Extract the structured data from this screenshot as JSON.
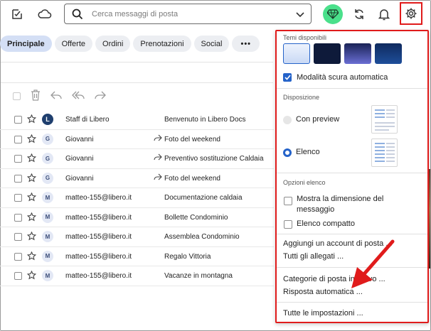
{
  "search": {
    "placeholder": "Cerca messaggi di posta"
  },
  "tabs": [
    {
      "label": "Principale",
      "active": true
    },
    {
      "label": "Offerte"
    },
    {
      "label": "Ordini"
    },
    {
      "label": "Prenotazioni"
    },
    {
      "label": "Social"
    },
    {
      "label": "•••"
    }
  ],
  "emails": [
    {
      "initial": "L",
      "sender": "Staff di Libero",
      "subject": "Benvenuto in Libero Docs",
      "forwarded": false
    },
    {
      "initial": "G",
      "sender": "Giovanni",
      "subject": "Foto del weekend",
      "forwarded": true
    },
    {
      "initial": "G",
      "sender": "Giovanni",
      "subject": "Preventivo sostituzione Caldaia",
      "forwarded": true
    },
    {
      "initial": "G",
      "sender": "Giovanni",
      "subject": "Foto del weekend",
      "forwarded": true
    },
    {
      "initial": "M",
      "sender": "matteo-155@libero.it",
      "subject": "Documentazione caldaia",
      "forwarded": false
    },
    {
      "initial": "M",
      "sender": "matteo-155@libero.it",
      "subject": "Bollette Condominio",
      "forwarded": false
    },
    {
      "initial": "M",
      "sender": "matteo-155@libero.it",
      "subject": "Assemblea Condominio",
      "forwarded": false
    },
    {
      "initial": "M",
      "sender": "matteo-155@libero.it",
      "subject": "Regalo Vittoria",
      "forwarded": false
    },
    {
      "initial": "M",
      "sender": "matteo-155@libero.it",
      "subject": "Vacanze in montagna",
      "forwarded": false
    }
  ],
  "settings": {
    "themes_heading": "Temi disponibili",
    "auto_dark_label": "Modalità scura automatica",
    "auto_dark_checked": true,
    "layout_heading": "Disposizione",
    "layout_preview_label": "Con preview",
    "layout_list_label": "Elenco",
    "layout_selected": "list",
    "list_options_heading": "Opzioni elenco",
    "show_size_label_1": "Mostra la dimensione del",
    "show_size_label_2": "messaggio",
    "compact_label": "Elenco compatto",
    "add_account_link": "Aggiungi un account di posta ...",
    "attachments_link": "Tutti gli allegati ...",
    "categories_link": "Categorie di posta in arrivo ...",
    "auto_reply_link": "Risposta automatica ...",
    "all_settings_link": "Tutte le impostazioni ..."
  },
  "colors": {
    "accent": "#2563c9",
    "gem": "#4ae08b",
    "annotation": "#e01b1b",
    "theme_1": "#dbe6fb",
    "theme_2": "#0e1a3a",
    "theme_3": "#3a3f9e",
    "theme_4": "#17366e"
  }
}
